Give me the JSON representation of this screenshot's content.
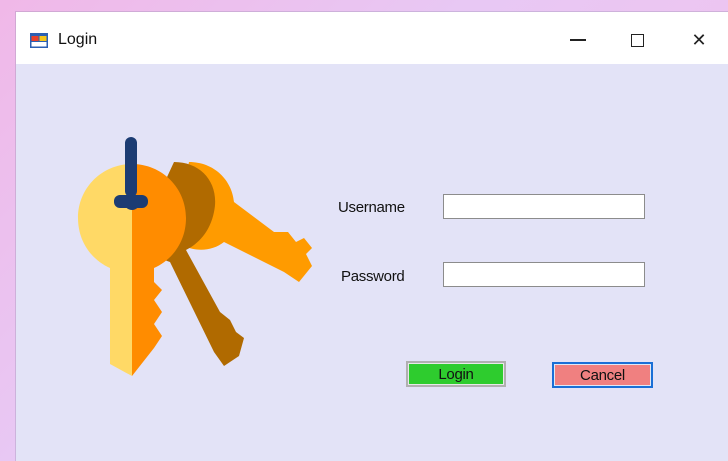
{
  "window": {
    "title": "Login",
    "app_icon": "form-app-icon",
    "controls": {
      "minimize": "minimize-icon",
      "maximize": "maximize-icon",
      "close_glyph": "✕"
    }
  },
  "illustration": {
    "icon": "keys-illustration",
    "colors": [
      "#ffd966",
      "#ff9b00",
      "#b06a00",
      "#1c3c73"
    ]
  },
  "form": {
    "username_label": "Username",
    "username_value": "",
    "password_label": "Password",
    "password_value": "",
    "login_button": "Login",
    "cancel_button": "Cancel"
  },
  "colors": {
    "window_bg": "#e3e3f7",
    "login_button_bg": "#2ecc2e",
    "cancel_button_bg": "#f08080",
    "focus_border": "#1a6fd6"
  }
}
